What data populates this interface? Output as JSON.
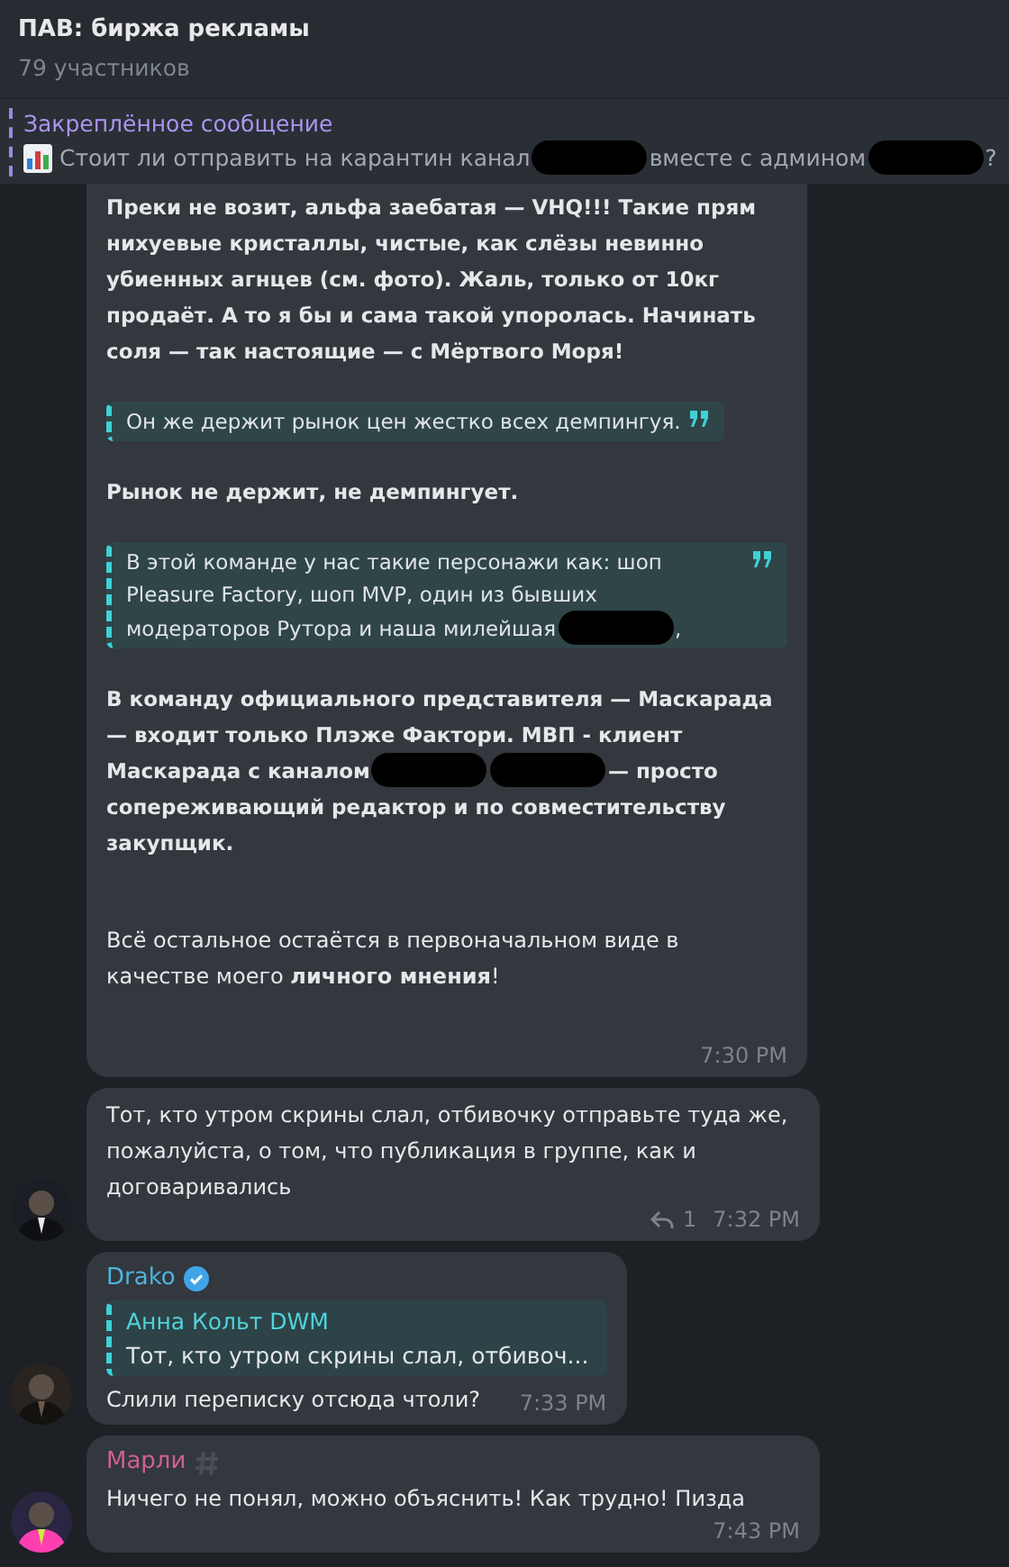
{
  "header": {
    "title": "ПАВ: биржа рекламы",
    "subtitle": "79 участников"
  },
  "pinned": {
    "label": "Закреплённое сообщение",
    "segments": [
      {
        "kind": "text",
        "text": "Стоит ли отправить на карантин канал"
      },
      {
        "kind": "redacted"
      },
      {
        "kind": "text",
        "text": "вместе с админом"
      },
      {
        "kind": "redacted"
      },
      {
        "kind": "text",
        "text": "?"
      }
    ]
  },
  "messages": [
    {
      "blocks": [
        {
          "kind": "paragraph",
          "bold": true,
          "segments": [
            {
              "kind": "text",
              "text": "Преки не возит, альфа заебатая — VHQ!!! Такие прям нихуевые кристаллы, чистые, как слёзы невинно убиенных агнцев (см. фото). Жаль, только от 10кг продаёт. А то я бы и сама такой упоролась. Начинать соля — так настоящие — с Мёртвого Моря!"
            }
          ]
        },
        {
          "kind": "quote",
          "segments": [
            {
              "kind": "text",
              "text": "Он же держит рынок цен жестко всех демпингуя."
            }
          ]
        },
        {
          "kind": "paragraph",
          "bold": true,
          "segments": [
            {
              "kind": "text",
              "text": "Рынок не держит, не демпингует."
            }
          ]
        },
        {
          "kind": "quote",
          "segments": [
            {
              "kind": "text",
              "text": "В этой команде у нас такие персонажи как: шоп Pleasure Factory, шоп MVP, один из бывших модераторов Рутора и наша милейшая"
            },
            {
              "kind": "redacted"
            },
            {
              "kind": "text",
              "text": ","
            }
          ]
        },
        {
          "kind": "paragraph",
          "bold": true,
          "segments": [
            {
              "kind": "text",
              "text": "В команду официального представителя — Маскарада — входит только Плэже Фактори. МВП - клиент Маскарада с каналом"
            },
            {
              "kind": "redacted"
            },
            {
              "kind": "redacted"
            },
            {
              "kind": "text",
              "text": "— просто сопереживающий редактор и по совместительству закупщик."
            }
          ]
        },
        {
          "kind": "paragraph",
          "bold": false,
          "segments": [
            {
              "kind": "text",
              "text": "Всё остальное остаётся в первоначальном виде в качестве моего **личного мнения**!"
            }
          ]
        }
      ],
      "time": "7:30 PM"
    },
    {
      "avatar": true,
      "blocks": [
        {
          "kind": "paragraph",
          "bold": false,
          "segments": [
            {
              "kind": "text",
              "text": "Тот, кто утром скрины слал, отбивочку отправьте туда же, пожалуйста, о том, что публикация в группе, как и договаривались"
            }
          ]
        }
      ],
      "replies": "1",
      "time": "7:32 PM"
    },
    {
      "avatar": true,
      "sender": {
        "name": "Drako",
        "color": "#4fb3d9",
        "verified": true
      },
      "reply": {
        "name": "Анна Кольт DWM",
        "text": "Тот, кто утром скрины слал, отбивоч..."
      },
      "blocks": [
        {
          "kind": "paragraph",
          "bold": false,
          "segments": [
            {
              "kind": "text",
              "text": "Слили переписку отсюда чтоли?"
            }
          ]
        }
      ],
      "time": "7:33 PM"
    },
    {
      "avatar": true,
      "sender": {
        "name": "Марли",
        "color": "#d0618d",
        "emoji_status": true
      },
      "blocks": [
        {
          "kind": "paragraph",
          "bold": false,
          "segments": [
            {
              "kind": "text",
              "text": "Ничего не понял, можно объяснить! Как трудно! Пизда"
            }
          ]
        }
      ],
      "time": "7:43 PM"
    }
  ]
}
